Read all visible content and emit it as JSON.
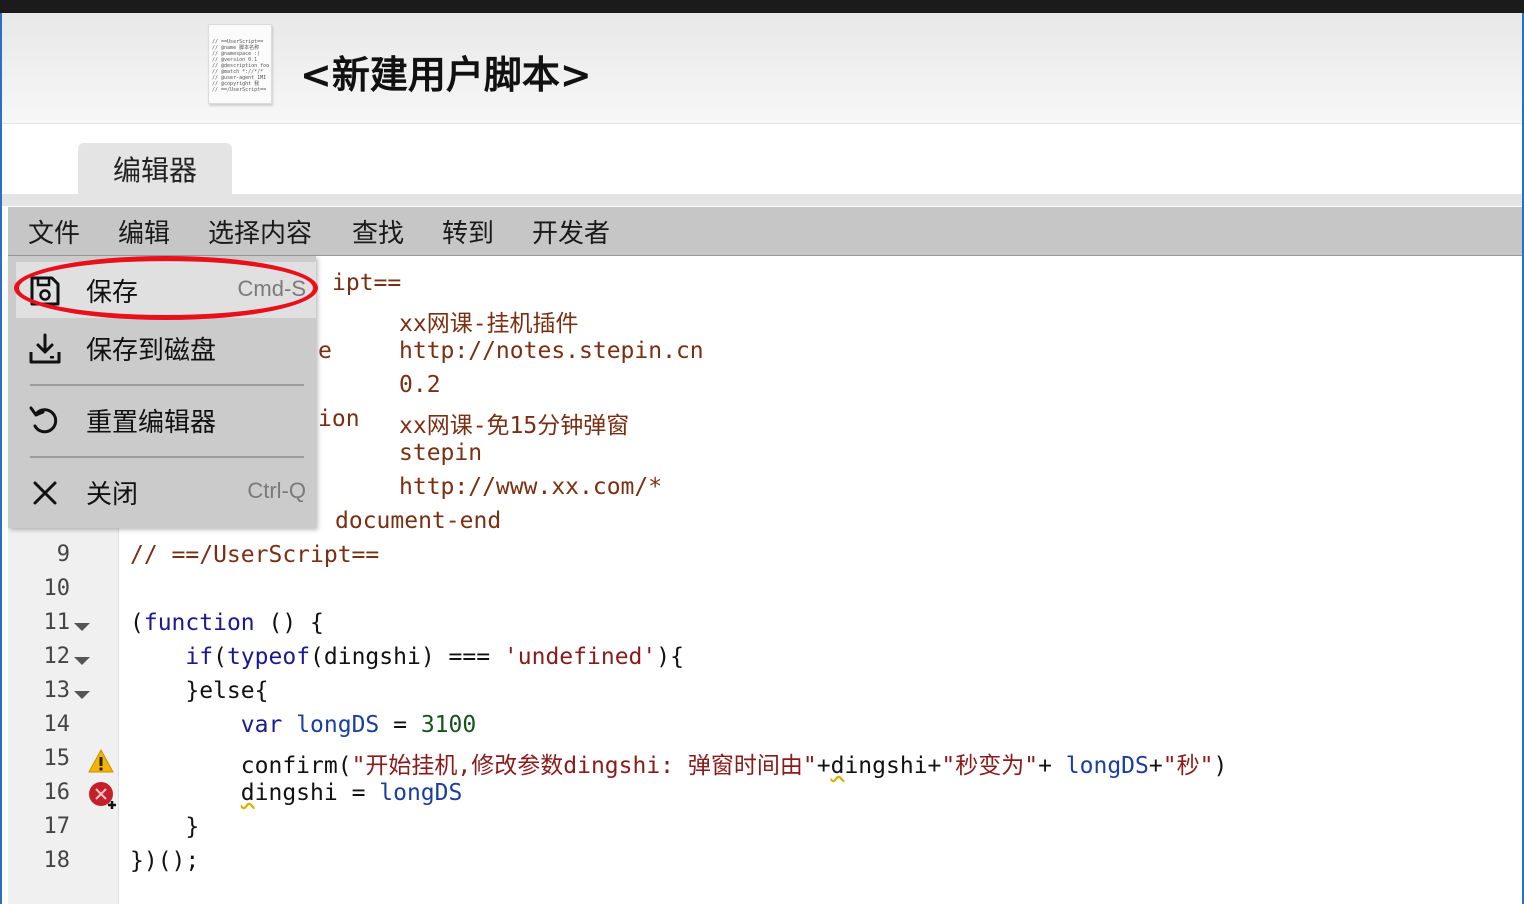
{
  "header": {
    "script_title": "<新建用户脚本>",
    "thumbnail_lines": [
      "// ==UserScript==",
      "// @name  脚本名称",
      "// @namespace :)",
      "// @version  0.1",
      "// @description foo",
      "// @match   *://*/*",
      "// @user-agent 1MI",
      "// @copyright  我",
      "// ==/UserScript=="
    ]
  },
  "tabs": {
    "editor": "编辑器"
  },
  "menubar": {
    "file": "文件",
    "edit": "编辑",
    "select": "选择内容",
    "find": "查找",
    "goto": "转到",
    "developer": "开发者"
  },
  "file_menu": {
    "save": {
      "label": "保存",
      "shortcut": "Cmd-S"
    },
    "save_to_disk": {
      "label": "保存到磁盘"
    },
    "reset_editor": {
      "label": "重置编辑器"
    },
    "close": {
      "label": "关闭",
      "shortcut": "Ctrl-Q"
    }
  },
  "gutter": {
    "line_numbers": [
      "9",
      "10",
      "11",
      "12",
      "13",
      "14",
      "15",
      "16",
      "17",
      "18"
    ]
  },
  "code": {
    "l1_tail": "ipt==",
    "l2_value": "xx网课-挂机插件",
    "l3_key_tail": "e",
    "l3_value": "http://notes.stepin.cn",
    "l4_value": "0.2",
    "l5_key_tail": "ion",
    "l5_value": "xx网课-免15分钟弹窗",
    "l6_value": "stepin",
    "l7_value": "http://www.xx.com/*",
    "l8_value": "document-end",
    "l9": "// ==/UserScript==",
    "l11_fn": "function",
    "l11_rest": " () {",
    "l12_if": "if",
    "l12_typeof": "typeof",
    "l12_mid": "(dingshi) === ",
    "l12_str": "'undefined'",
    "l12_end": "){",
    "l13": "}else{",
    "l14_var": "var",
    "l14_name": "longDS",
    "l14_eq": " = ",
    "l14_num": "3100",
    "l15_call": "confirm(",
    "l15_str1": "\"开始挂机,修改参数dingshi: 弹窗时间由\"",
    "l15_plus1": "+",
    "l15_d": "d",
    "l15_ingshi": "ingshi+",
    "l15_str2": "\"秒变为\"",
    "l15_plus2": "+ ",
    "l15_longds": "longDS",
    "l15_plus3": "+",
    "l15_str3": "\"秒\"",
    "l15_end": ")",
    "l16_d": "d",
    "l16_rest": "ingshi = ",
    "l16_longds": "longDS",
    "l17": "}",
    "l18": "})();"
  },
  "colors": {
    "highlight_ring": "#e8101a",
    "menubar": "#c6c6c6",
    "dropdown": "#cbcbcb"
  }
}
